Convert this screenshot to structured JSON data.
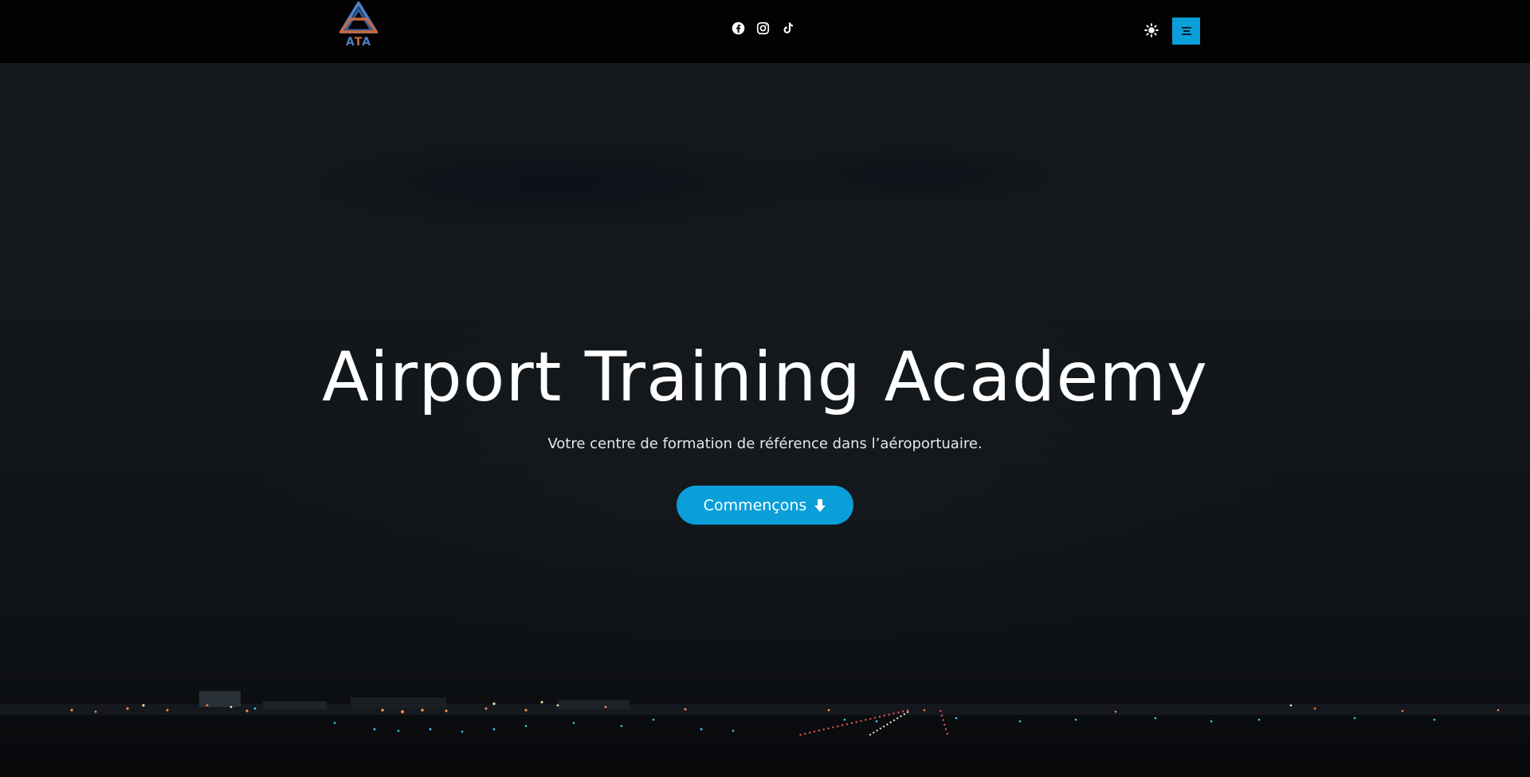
{
  "header": {
    "logo": {
      "text_left": "A",
      "text_mid": "T",
      "text_right": "A",
      "colors": {
        "blue": "#4f7fc0",
        "orange": "#c9683d"
      }
    },
    "socials": [
      {
        "icon": "facebook-icon"
      },
      {
        "icon": "instagram-icon"
      },
      {
        "icon": "tiktok-icon"
      }
    ],
    "theme_toggle_icon": "sun-icon",
    "menu_icon": "menu-icon"
  },
  "hero": {
    "title": "Airport Training Academy",
    "subtitle": "Votre centre de formation de référence dans l’aéroportuaire.",
    "cta_label": "Commençons",
    "cta_icon": "arrow-down-icon"
  },
  "colors": {
    "accent": "#0a9fd9",
    "navbar_bg": "#020203",
    "hero_bg": "#13181c"
  }
}
